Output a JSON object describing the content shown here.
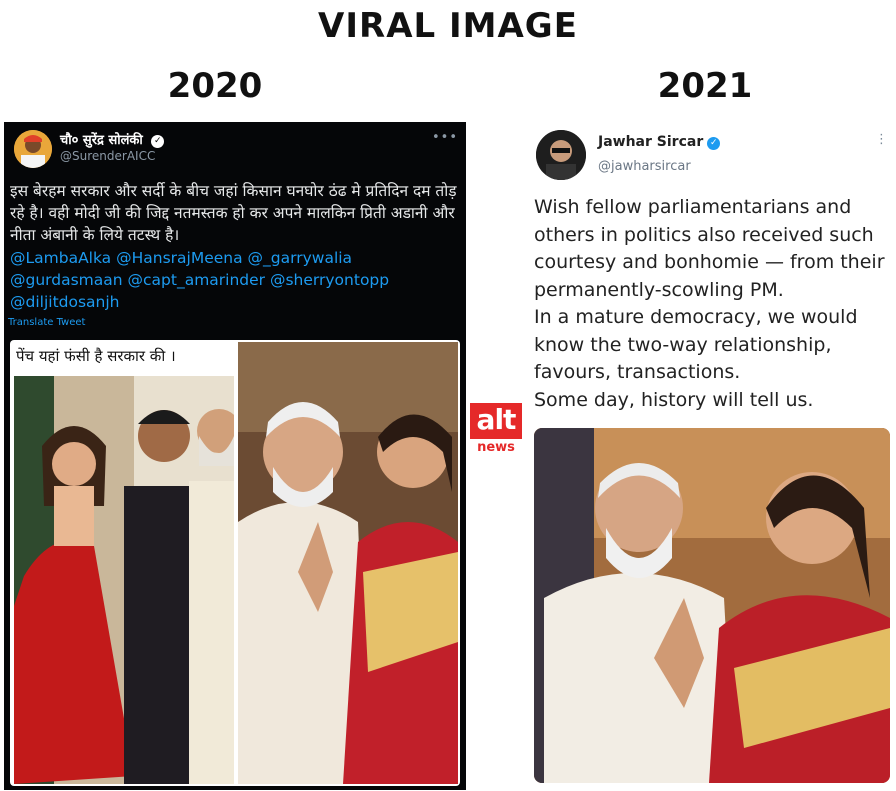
{
  "heading": "VIRAL IMAGE",
  "left": {
    "year": "2020",
    "tweet": {
      "name": "चौ० सुरेंद्र सोलंकी",
      "handle": "@SurenderAICC",
      "text": "इस बेरहम सरकार और सर्दी के बीच जहां किसान घनघोर ठंढ मे प्रतिदिन दम तोड़ रहे है। वही मोदी जी की जिद्द नतमस्तक हो कर अपने मालकिन प्रिती अडानी और नीता अंबानी के लिये तटस्थ है।",
      "mentions": "@LambaAlka @HansrajMeena @_garrywalia @gurdasmaan @capt_amarinder @sherryontopp @diljitdosanjh",
      "translate": "Translate Tweet",
      "image_caption": "पेंच यहां फंसी है सरकार की ।"
    }
  },
  "right": {
    "year": "2021",
    "tweet": {
      "name": "Jawhar Sircar",
      "handle": "@jawharsircar",
      "paragraphs": [
        "Wish fellow parliamentarians and others in politics also received such courtesy and bonhomie — from their permanently-scowling PM.",
        "In a mature democracy, we would know the two-way relationship, favours, transactions.",
        "Some day, history will tell us."
      ]
    }
  },
  "logo": {
    "top": "alt",
    "bottom": "news"
  },
  "icons": {
    "verified": "verified-badge-icon",
    "more": "more-options-icon"
  },
  "colors": {
    "dark_bg": "#050608",
    "link": "#1d9bf0",
    "brand_red": "#e52929"
  }
}
